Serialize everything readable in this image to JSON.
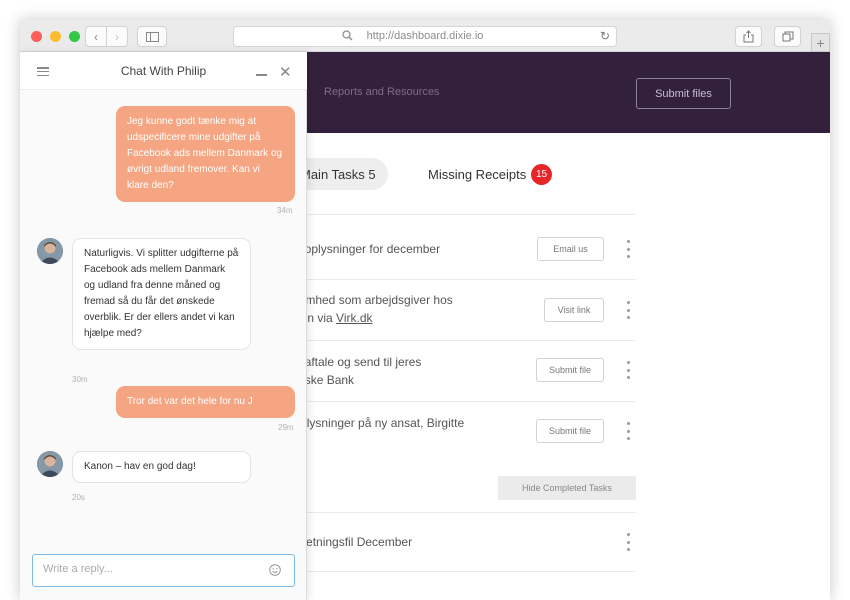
{
  "browser": {
    "url": "http://dashboard.dixie.io"
  },
  "header": {
    "nav_reports": "Reports and Resources",
    "submit_files": "Submit files"
  },
  "tabs": {
    "main_tasks": "Main Tasks 5",
    "missing_receipts": "Missing Receipts",
    "missing_receipts_count": "15"
  },
  "tasks": [
    {
      "line1": "orter lønoplysninger for december",
      "line2": "",
      "button": "Email us"
    },
    {
      "line1": "er virksomhed som arbejdsgiver hos",
      "line2_prefix": "sstyrelsen via ",
      "link": "Virk.dk",
      "button": "Visit link"
    },
    {
      "line1": "riv Nets-aftale og send til jeres",
      "line2": "hos Danske Bank",
      "button": "Submit file"
    },
    {
      "line1": "nd lønoplysninger på ny ansat, Birgitte",
      "line2": "",
      "button": "Submit file"
    }
  ],
  "hide_completed": "Hide Completed Tasks",
  "completed_task": "ipe omsætningsfil December",
  "chat": {
    "title": "Chat With Philip",
    "messages": [
      {
        "from": "user",
        "text": "Jeg kunne godt tænke mig at udspecificere mine udgifter på Facebook ads mellem Danmark og øvrigt udland fremover. Kan vi klare den?",
        "time": "34m"
      },
      {
        "from": "agent",
        "text": "Naturligvis. Vi splitter udgifterne på Facebook ads mellem Danmark og udland fra denne måned og fremad så du får det ønskede overblik. Er der ellers andet vi kan hjælpe med?",
        "time": "30m"
      },
      {
        "from": "user",
        "text": "Tror det var det hele for nu J",
        "time": "29m"
      },
      {
        "from": "agent",
        "text": "Kanon – hav en god dag!",
        "time": "20s"
      }
    ],
    "reply_placeholder": "Write a reply..."
  },
  "colors": {
    "header_bg": "#33203d",
    "user_bubble": "#f6a582",
    "badge": "#e8262a"
  }
}
